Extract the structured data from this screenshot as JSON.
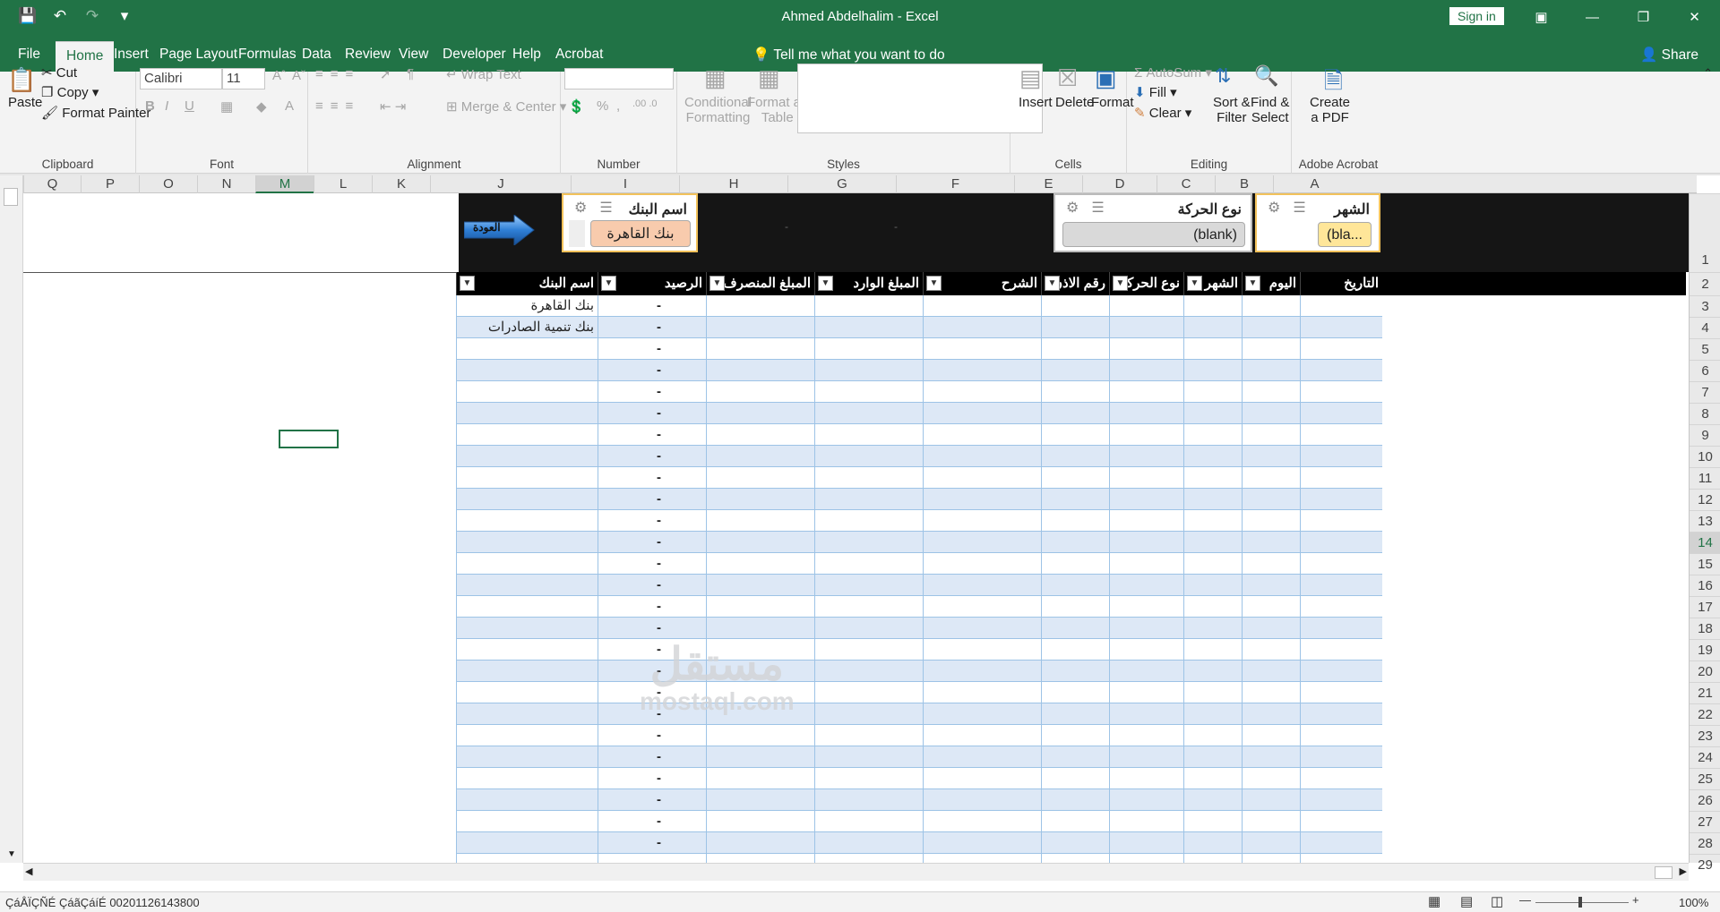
{
  "window": {
    "title": "Ahmed Abdelhalim  -  Excel",
    "signin": "Sign in"
  },
  "qat": {
    "save_icon": "save-icon",
    "undo_icon": "undo-icon",
    "redo_icon": "redo-icon",
    "customize_icon": "customize-icon"
  },
  "tabs": [
    "File",
    "Home",
    "Insert",
    "Page Layout",
    "Formulas",
    "Data",
    "Review",
    "View",
    "Developer",
    "Help",
    "Acrobat"
  ],
  "tellme": "Tell me what you want to do",
  "share": "Share",
  "ribbon": {
    "clipboard": {
      "paste": "Paste",
      "cut": "Cut",
      "copy": "Copy",
      "format_painter": "Format Painter",
      "label": "Clipboard"
    },
    "font": {
      "name": "Calibri",
      "size": "11",
      "label": "Font"
    },
    "alignment": {
      "wrap": "Wrap Text",
      "merge": "Merge & Center",
      "label": "Alignment"
    },
    "number": {
      "label": "Number"
    },
    "styles": {
      "conditional": "Conditional",
      "conditional2": "Formatting",
      "format_as": "Format as",
      "format_as2": "Table",
      "label": "Styles"
    },
    "cells": {
      "insert": "Insert",
      "delete": "Delete",
      "format": "Format",
      "label": "Cells"
    },
    "editing": {
      "autosum": "AutoSum",
      "fill": "Fill",
      "clear": "Clear",
      "sort": "Sort &",
      "sort2": "Filter",
      "find": "Find &",
      "find2": "Select",
      "label": "Editing"
    },
    "acrobat": {
      "create": "Create",
      "create2": "a PDF",
      "label": "Adobe Acrobat"
    }
  },
  "columns": [
    "Q",
    "P",
    "O",
    "N",
    "M",
    "L",
    "K",
    "J",
    "I",
    "H",
    "G",
    "F",
    "E",
    "D",
    "C",
    "B",
    "A"
  ],
  "rows": [
    "1",
    "2",
    "3",
    "4",
    "5",
    "6",
    "7",
    "8",
    "9",
    "10",
    "11",
    "12",
    "13",
    "14",
    "15",
    "16",
    "17",
    "18",
    "19",
    "20",
    "21",
    "22",
    "23",
    "24",
    "25",
    "26",
    "27",
    "28",
    "29"
  ],
  "slicers": {
    "month": {
      "title": "الشهر",
      "item": "(bla..."
    },
    "type": {
      "title": "نوع الحركة",
      "item": "(blank)"
    },
    "bank": {
      "title": "اسم البنك",
      "item": "بنك القاهرة"
    }
  },
  "band_dashes": [
    "-",
    "-"
  ],
  "back_button": "العودة",
  "table_headers": {
    "date": "التاريخ",
    "day": "اليوم",
    "month": "الشهر",
    "type": "نوع الحركة",
    "permit": "رقم الاذن",
    "desc": "الشرح",
    "in": "المبلغ الوارد",
    "out": "المبلغ المنصرف",
    "balance": "الرصيد",
    "bank": "اسم البنك"
  },
  "table_rows": [
    {
      "bank": "بنك القاهرة",
      "balance": "-"
    },
    {
      "bank": "بنك تنمية الصادرات",
      "balance": "-"
    },
    {
      "bank": "",
      "balance": "-"
    },
    {
      "bank": "",
      "balance": "-"
    },
    {
      "bank": "",
      "balance": "-"
    },
    {
      "bank": "",
      "balance": "-"
    },
    {
      "bank": "",
      "balance": "-"
    },
    {
      "bank": "",
      "balance": "-"
    },
    {
      "bank": "",
      "balance": "-"
    },
    {
      "bank": "",
      "balance": "-"
    },
    {
      "bank": "",
      "balance": "-"
    },
    {
      "bank": "",
      "balance": "-"
    },
    {
      "bank": "",
      "balance": "-"
    },
    {
      "bank": "",
      "balance": "-"
    },
    {
      "bank": "",
      "balance": "-"
    },
    {
      "bank": "",
      "balance": "-"
    },
    {
      "bank": "",
      "balance": "-"
    },
    {
      "bank": "",
      "balance": "-"
    },
    {
      "bank": "",
      "balance": "-"
    },
    {
      "bank": "",
      "balance": "-"
    },
    {
      "bank": "",
      "balance": "-"
    },
    {
      "bank": "",
      "balance": "-"
    },
    {
      "bank": "",
      "balance": "-"
    },
    {
      "bank": "",
      "balance": "-"
    },
    {
      "bank": "",
      "balance": "-"
    },
    {
      "bank": "",
      "balance": "-"
    },
    {
      "bank": "",
      "balance": "-"
    }
  ],
  "watermark": {
    "line1": "مستقل",
    "line2": "mostaql.com"
  },
  "status": {
    "text": "ÇáÅÏÇÑÉ ÇáãÇáíÉ 00201126143800",
    "zoom": "100%"
  }
}
